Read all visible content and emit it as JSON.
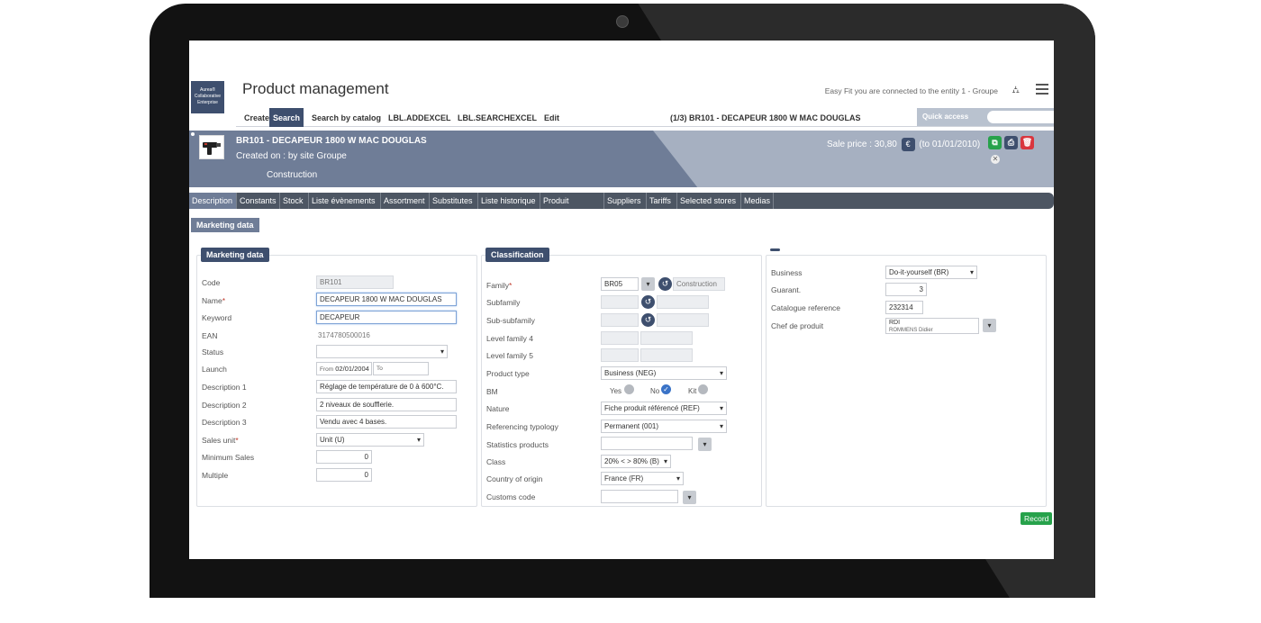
{
  "header": {
    "logo_text": "Aurea\nCollaborative\nEnterprise",
    "title": "Product  management",
    "entity_info": "Easy Fit you are connected to the entity 1 - Groupe"
  },
  "toolbar": {
    "items": [
      "Create",
      "Search",
      "Search by catalog",
      "LBL.ADDEXCEL",
      "LBL.SEARCHEXCEL",
      "Edit"
    ],
    "record_info": "(1/3)  BR101 - DECAPEUR 1800 W MAC DOUGLAS",
    "quick_access": "Quick access"
  },
  "banner": {
    "title": "BR101 - DECAPEUR 1800 W MAC DOUGLAS",
    "created": "Created on :  by site Groupe",
    "family": "Construction",
    "price": "Sale price :  30,80",
    "price_date": "(to 01/01/2010)"
  },
  "tabs": [
    "Description",
    "Constants",
    "Stock",
    "Liste évènements",
    "Assortment",
    "Substitutes",
    "Liste historique",
    "Produit dispatch",
    "Suppliers",
    "Tariffs",
    "Selected stores",
    "Medias"
  ],
  "section_tab": "Marketing data",
  "marketing": {
    "title": "Marketing data",
    "code_label": "Code",
    "code": "BR101",
    "name_label": "Name",
    "name": "DECAPEUR 1800 W MAC DOUGLAS",
    "keyword_label": "Keyword",
    "keyword": "DECAPEUR",
    "ean_label": "EAN",
    "ean": "3174780500016",
    "status_label": "Status",
    "status": "",
    "launch_label": "Launch",
    "from_label": "From",
    "from": "02/01/2004",
    "to_label": "To",
    "desc1_label": "Description 1",
    "desc1": "Réglage de température de 0 à 600°C.",
    "desc2_label": "Description 2",
    "desc2": "2 niveaux de soufflerie.",
    "desc3_label": "Description 3",
    "desc3": "Vendu avec 4 bases.",
    "sales_unit_label": "Sales unit",
    "sales_unit": "Unit (U)",
    "min_sales_label": "Minimum Sales",
    "min_sales": "0",
    "multiple_label": "Multiple",
    "multiple": "0"
  },
  "classification": {
    "title": "Classification",
    "family_label": "Family",
    "family_code": "BR05",
    "family_name": "Construction",
    "subfamily_label": "Subfamily",
    "subsubfamily_label": "Sub-subfamily",
    "level4_label": "Level family 4",
    "level5_label": "Level family 5",
    "product_type_label": "Product type",
    "product_type": "Business (NEG)",
    "bm_label": "BM",
    "bm_yes": "Yes",
    "bm_no": "No",
    "bm_kit": "Kit",
    "nature_label": "Nature",
    "nature": "Fiche produit référencé (REF)",
    "ref_typology_label": "Referencing typology",
    "ref_typology": "Permanent (001)",
    "stats_label": "Statistics products",
    "class_label": "Class",
    "class": "20% < > 80% (B)",
    "country_label": "Country of origin",
    "country": "France (FR)",
    "customs_label": "Customs code"
  },
  "business_panel": {
    "business_label": "Business",
    "business": "Do-it-yourself (BR)",
    "guarant_label": "Guarant.",
    "guarant": "3",
    "catalogue_label": "Catalogue reference",
    "catalogue": "232314",
    "chef_label": "Chef de produit",
    "chef_line1": "RDI",
    "chef_line2": "ROMMENS Didier"
  },
  "record_label": "Record",
  "colors": {
    "brand": "#3e4f6e",
    "banner": "#6f7d97",
    "tabs": "#4d5663",
    "record": "#27a24b"
  }
}
